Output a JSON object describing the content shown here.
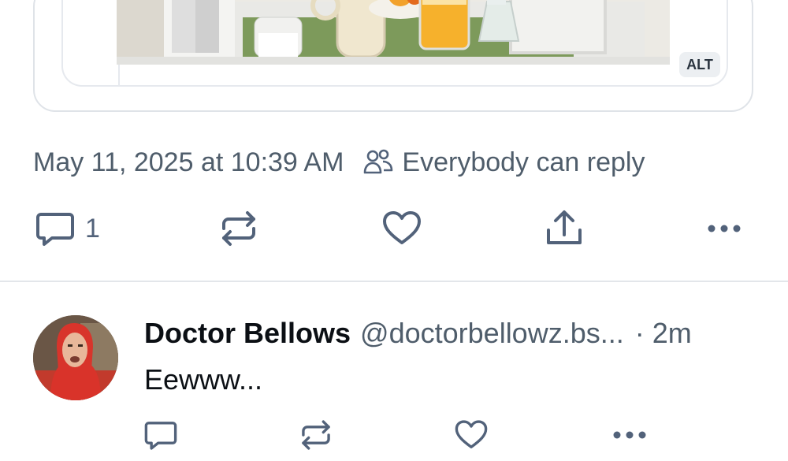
{
  "post": {
    "alt_label": "ALT",
    "timestamp": "May 11, 2025 at 10:39 AM",
    "reply_setting": "Everybody can reply",
    "reply_count": "1"
  },
  "reply": {
    "display_name": "Doctor Bellows",
    "handle": "@doctorbellowz.bs...",
    "time": "· 2m",
    "text": "Eewww..."
  },
  "icons": {
    "reply": "speech-bubble-icon",
    "repost": "repost-arrows-icon",
    "like": "heart-icon",
    "share": "share-upload-icon",
    "more": "more-dots-icon",
    "audience": "people-icon"
  },
  "colors": {
    "muted_text": "#4f5d6b",
    "icon": "#52627a",
    "border": "#dfe3e8"
  }
}
